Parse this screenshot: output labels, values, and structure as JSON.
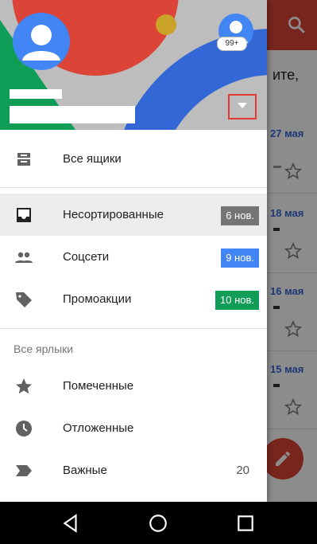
{
  "background": {
    "partial_text": "ите,",
    "dates": [
      "27 мая",
      "18 мая",
      "16 мая",
      "15 мая"
    ]
  },
  "header": {
    "badge": "99+"
  },
  "drawer": {
    "all_inboxes": "Все ящики",
    "items": [
      {
        "label": "Несортированные",
        "count": "6 нов.",
        "color": "#757575"
      },
      {
        "label": "Соцсети",
        "count": "9 нов.",
        "color": "#4285f4"
      },
      {
        "label": "Промоакции",
        "count": "10 нов.",
        "color": "#0f9d58"
      }
    ],
    "section_title": "Все ярлыки",
    "labels": [
      {
        "label": "Помеченные",
        "icon": "star-icon"
      },
      {
        "label": "Отложенные",
        "icon": "clock-icon"
      },
      {
        "label": "Важные",
        "icon": "important-icon",
        "count": "20"
      }
    ]
  },
  "colors": {
    "header_red": "#db4437",
    "header_green": "#0f9d58",
    "header_blue": "#3367d6",
    "header_yellow": "#f4b400"
  }
}
